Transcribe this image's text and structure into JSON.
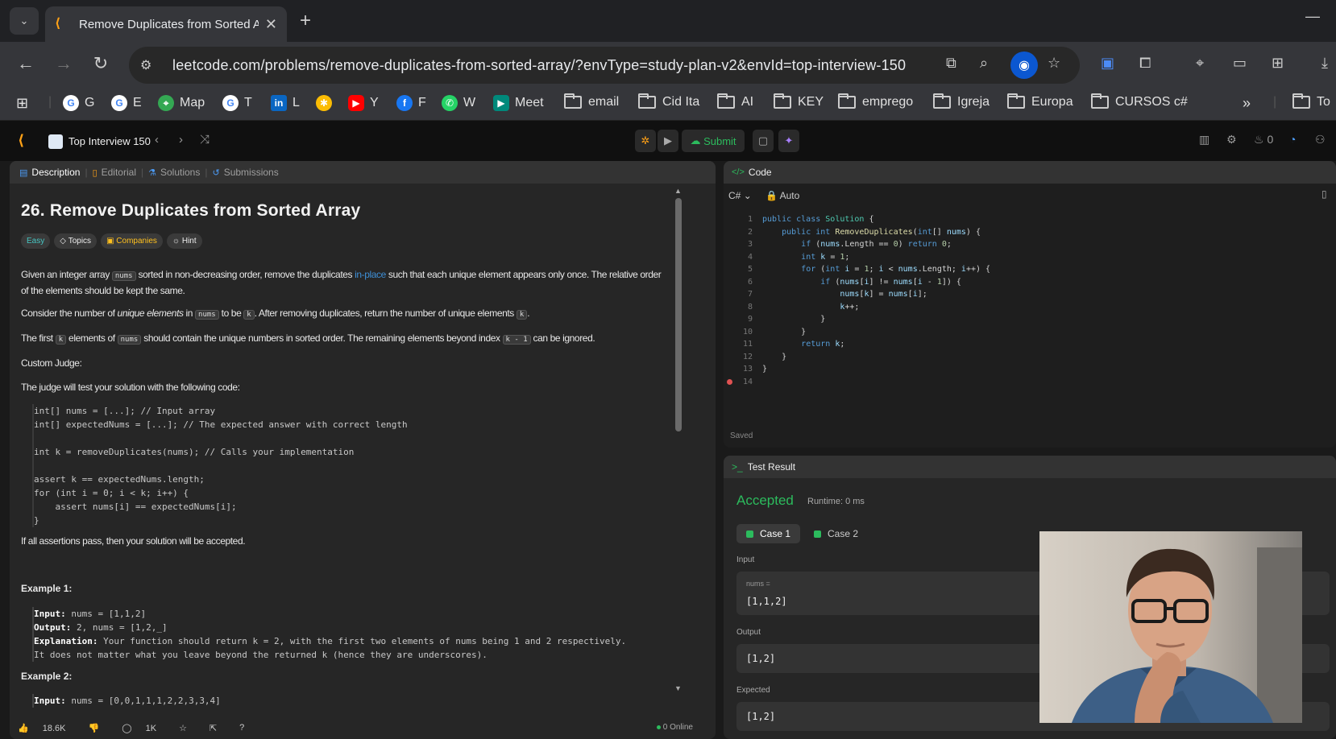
{
  "browser": {
    "tab_title": "Remove Duplicates from Sorted Array",
    "url": "leetcode.com/problems/remove-duplicates-from-sorted-array/?envType=study-plan-v2&envId=top-interview-150",
    "bookmarks": [
      {
        "label": "G",
        "icon": "google-icon",
        "color": "#4285f4"
      },
      {
        "label": "E",
        "icon": "google-icon",
        "color": "#4285f4"
      },
      {
        "label": "Map",
        "icon": "maps-icon",
        "color": "#34a853"
      },
      {
        "label": "T",
        "icon": "google-icon",
        "color": "#4285f4"
      },
      {
        "label": "L",
        "icon": "linkedin-icon",
        "color": "#0a66c2"
      },
      {
        "label": "",
        "icon": "photos-icon",
        "color": "#fbbc04"
      },
      {
        "label": "Y",
        "icon": "youtube-icon",
        "color": "#ff0000"
      },
      {
        "label": "F",
        "icon": "facebook-icon",
        "color": "#1877f2"
      },
      {
        "label": "W",
        "icon": "whatsapp-icon",
        "color": "#25d366"
      },
      {
        "label": "Meet",
        "icon": "meet-icon",
        "color": "#00897b"
      },
      {
        "label": "email",
        "icon": "folder-icon"
      },
      {
        "label": "Cid Ita",
        "icon": "folder-icon"
      },
      {
        "label": "AI",
        "icon": "folder-icon"
      },
      {
        "label": "KEY",
        "icon": "folder-icon"
      },
      {
        "label": "emprego",
        "icon": "folder-icon"
      },
      {
        "label": "Igreja",
        "icon": "folder-icon"
      },
      {
        "label": "Europa",
        "icon": "folder-icon"
      },
      {
        "label": "CURSOS c#",
        "icon": "folder-icon"
      },
      {
        "label": "To",
        "icon": "folder-icon"
      }
    ]
  },
  "header": {
    "study_plan": "Top Interview 150",
    "submit": "Submit",
    "streak": "0"
  },
  "desc_tabs": [
    "Description",
    "Editorial",
    "Solutions",
    "Submissions"
  ],
  "problem": {
    "title": "26. Remove Duplicates from Sorted Array",
    "chips": [
      "Easy",
      "Topics",
      "Companies",
      "Hint"
    ],
    "p1a": "Given an integer array ",
    "p1code": "nums",
    "p1b": " sorted in non-decreasing order, remove the duplicates ",
    "p1link": "in-place",
    "p1c": " such that each unique element appears only once. The relative order of the elements should be kept the same.",
    "p2a": "Consider the number of ",
    "p2em": "unique elements",
    "p2b": " in ",
    "p2code": "nums",
    "p2c": " to be ",
    "p2k": "k",
    "p2d": ". After removing duplicates, return the number of unique elements ",
    "p2k2": "k",
    "p2e": ".",
    "p3a": "The first ",
    "p3k": "k",
    "p3b": " elements of ",
    "p3code": "nums",
    "p3c": " should contain the unique numbers in sorted order. The remaining elements beyond index ",
    "p3code2": "k - 1",
    "p3d": " can be ignored.",
    "custom_judge": "Custom Judge:",
    "judge_intro": "The judge will test your solution with the following code:",
    "judge_code": "int[] nums = [...]; // Input array\nint[] expectedNums = [...]; // The expected answer with correct length\n\nint k = removeDuplicates(nums); // Calls your implementation\n\nassert k == expectedNums.length;\nfor (int i = 0; i < k; i++) {\n    assert nums[i] == expectedNums[i];\n}",
    "pass_text": "If all assertions pass, then your solution will be accepted.",
    "example1_title": "Example 1:",
    "ex1_input_lbl": "Input:",
    "ex1_input": " nums = [1,1,2]",
    "ex1_output_lbl": "Output:",
    "ex1_output": " 2, nums = [1,2,_]",
    "ex1_expl_lbl": "Explanation:",
    "ex1_expl": " Your function should return k = 2, with the first two elements of nums being 1 and 2 respectively.",
    "ex1_expl2": "It does not matter what you leave beyond the returned k (hence they are underscores).",
    "example2_title": "Example 2:",
    "ex2_input_lbl": "Input:",
    "ex2_input": " nums = [0,0,1,1,1,2,2,3,3,4]"
  },
  "footer": {
    "likes": "18.6K",
    "comments": "1K",
    "online": "0 Online"
  },
  "editor": {
    "title": "Code",
    "language": "C#",
    "mode": "Auto",
    "status": "Saved",
    "lines": [
      "1",
      "2",
      "3",
      "4",
      "5",
      "6",
      "7",
      "8",
      "9",
      "10",
      "11",
      "12",
      "13",
      "14"
    ],
    "code": {
      "l1": "public class Solution {",
      "l2": "    public int RemoveDuplicates(int[] nums) {",
      "l3": "        if (nums.Length == 0) return 0;",
      "l4": "        int k = 1;",
      "l5": "        for (int i = 1; i < nums.Length; i++) {",
      "l6": "            if (nums[i] != nums[i - 1]) {",
      "l7": "                nums[k] = nums[i];",
      "l8": "                k++;",
      "l9": "            }",
      "l10": "        }",
      "l11": "        return k;",
      "l12": "    }",
      "l13": "}",
      "l14": ""
    }
  },
  "result": {
    "title": "Test Result",
    "status": "Accepted",
    "runtime": "Runtime: 0 ms",
    "cases": [
      "Case 1",
      "Case 2"
    ],
    "input_lbl": "Input",
    "input_sub": "nums =",
    "input_val": "[1,1,2]",
    "output_lbl": "Output",
    "output_val": "[1,2]",
    "expected_lbl": "Expected",
    "expected_val": "[1,2]"
  }
}
